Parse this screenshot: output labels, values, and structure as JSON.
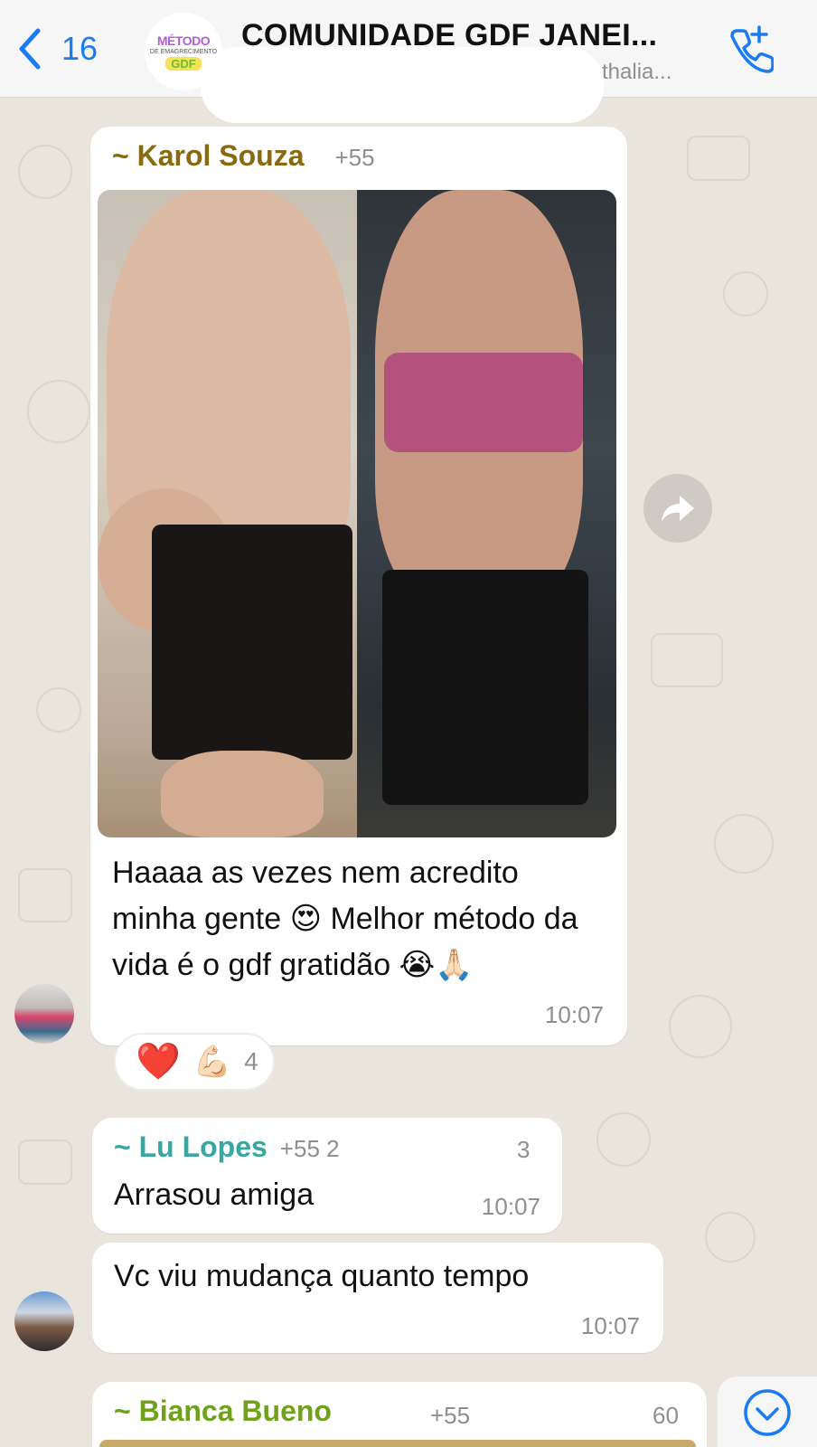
{
  "header": {
    "back_count": "16",
    "group_logo": {
      "top": "MÉTODO",
      "middle": "DE EMAGRECIMENTO",
      "bottom": "GDF"
    },
    "title": "COMUNIDADE GDF JANEI...",
    "subtitle": "thalia..."
  },
  "messages": [
    {
      "sender": "~ Karol Souza",
      "phone": "+55",
      "text": "Haaaa as vezes nem acredito minha gente 😍 Melhor método da vida é o gdf gratidão 😭🙏🏻",
      "time": "10:07",
      "reactions": {
        "emojis": [
          "❤️",
          "💪🏻"
        ],
        "count": "4"
      }
    },
    {
      "sender": "~ Lu Lopes",
      "phone": "+55 2",
      "phone_tail": "3",
      "text": "Arrasou amiga",
      "time": "10:07"
    },
    {
      "text": "Vc viu mudança quanto tempo",
      "time": "10:07"
    },
    {
      "sender": "~ Bianca Bueno",
      "phone": "+55",
      "phone_tail": "60"
    }
  ],
  "colors": {
    "accent_blue": "#1a7cf3",
    "karol_name": "#8a6a10",
    "lu_name": "#3aa6a0",
    "bianca_name": "#6fa11a",
    "chat_bg": "#e9e4dc"
  },
  "icons": [
    "chevron-left-icon",
    "call-add-icon",
    "forward-icon",
    "chevron-down-icon"
  ]
}
